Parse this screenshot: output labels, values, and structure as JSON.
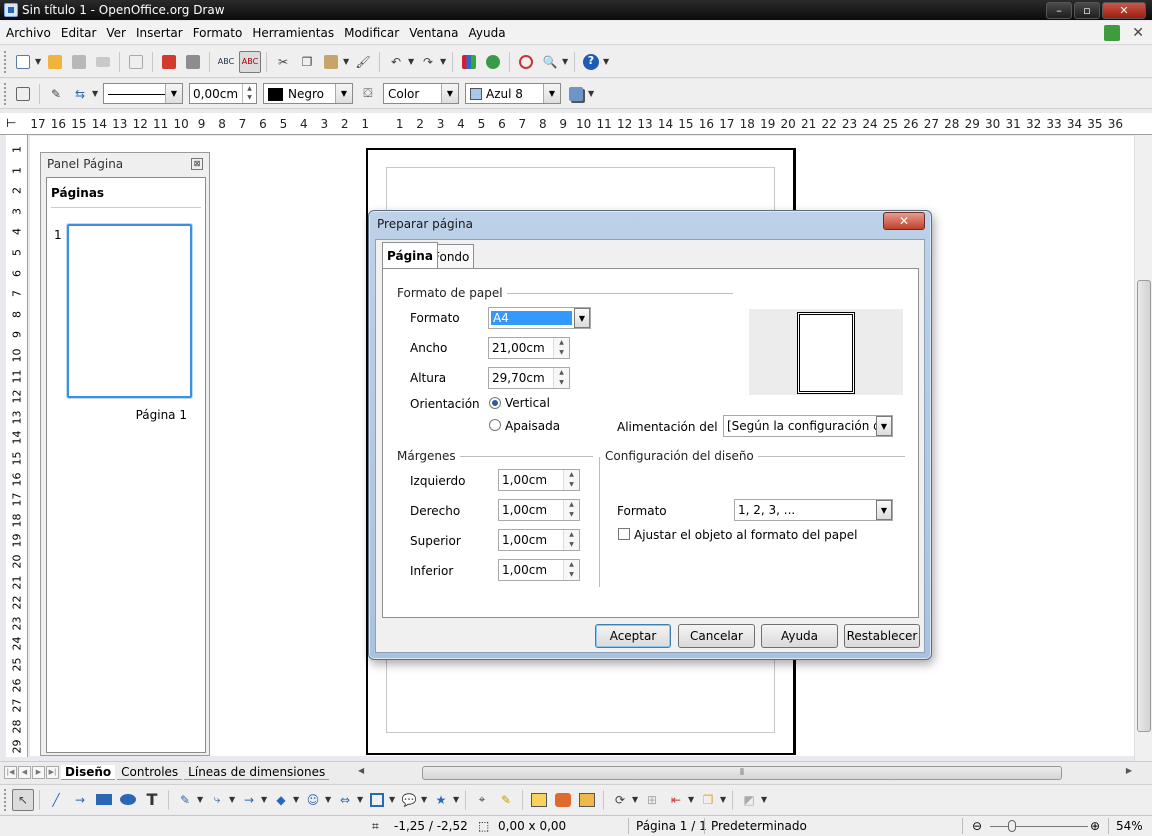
{
  "window": {
    "title": "Sin título 1 - OpenOffice.org Draw",
    "min": "–",
    "max": "▫",
    "close": "✕"
  },
  "menu": {
    "items": [
      "Archivo",
      "Editar",
      "Ver",
      "Insertar",
      "Formato",
      "Herramientas",
      "Modificar",
      "Ventana",
      "Ayuda"
    ],
    "close": "✕"
  },
  "toolbar2": {
    "line_width": "0,00cm",
    "line_color": "Negro",
    "fill_type": "Color",
    "fill_value": "Azul 8"
  },
  "colors": {
    "line_color_swatch": "#000000",
    "fill_swatch": "#a8c8f0",
    "accent": "#3399ff"
  },
  "hruler": [
    "17",
    "16",
    "15",
    "14",
    "13",
    "12",
    "11",
    "10",
    "9",
    "8",
    "7",
    "6",
    "5",
    "4",
    "3",
    "2",
    "1",
    "1",
    "2",
    "3",
    "4",
    "5",
    "6",
    "7",
    "8",
    "9",
    "10",
    "11",
    "12",
    "13",
    "14",
    "15",
    "16",
    "17",
    "18",
    "19",
    "20",
    "21",
    "22",
    "23",
    "24",
    "25",
    "26",
    "27",
    "28",
    "29",
    "30",
    "31",
    "32",
    "33",
    "34",
    "35",
    "36"
  ],
  "vruler": [
    "1",
    "1",
    "2",
    "3",
    "4",
    "5",
    "6",
    "7",
    "8",
    "9",
    "10",
    "11",
    "12",
    "13",
    "14",
    "15",
    "16",
    "17",
    "18",
    "19",
    "20",
    "21",
    "22",
    "23",
    "24",
    "25",
    "26",
    "27",
    "28",
    "29"
  ],
  "panel": {
    "title": "Panel Página",
    "close": "⊠",
    "section": "Páginas",
    "page_number": "1",
    "page_label": "Página 1"
  },
  "tabs": {
    "items": [
      "Diseño",
      "Controles",
      "Líneas de dimensiones"
    ]
  },
  "status": {
    "position": "-1,25 / -2,52",
    "size": "0,00 x 0,00",
    "page": "Página 1 / 1",
    "layout": "Predeterminado",
    "zoom": "54%"
  },
  "dialog": {
    "title": "Preparar página",
    "close": "✕",
    "tab_page": "Página",
    "tab_background": "Fondo",
    "paper_group": "Formato de papel",
    "format_label": "Formato",
    "format_value": "A4",
    "width_label": "Ancho",
    "width_value": "21,00cm",
    "height_label": "Altura",
    "height_value": "29,70cm",
    "orientation_label": "Orientación",
    "portrait": "Vertical",
    "landscape": "Apaisada",
    "paper_tray_label": "Alimentación del pa",
    "paper_tray_value": "[Según la configuración de l",
    "margins_group": "Márgenes",
    "left_label": "Izquierdo",
    "left_value": "1,00cm",
    "right_label": "Derecho",
    "right_value": "1,00cm",
    "top_label": "Superior",
    "top_value": "1,00cm",
    "bottom_label": "Inferior",
    "bottom_value": "1,00cm",
    "layout_group": "Configuración del diseño",
    "layout_format_label": "Formato",
    "layout_format_value": "1, 2, 3, ...",
    "fit_object": "Ajustar el objeto al formato del papel",
    "ok": "Aceptar",
    "cancel": "Cancelar",
    "help": "Ayuda",
    "reset": "Restablecer"
  }
}
